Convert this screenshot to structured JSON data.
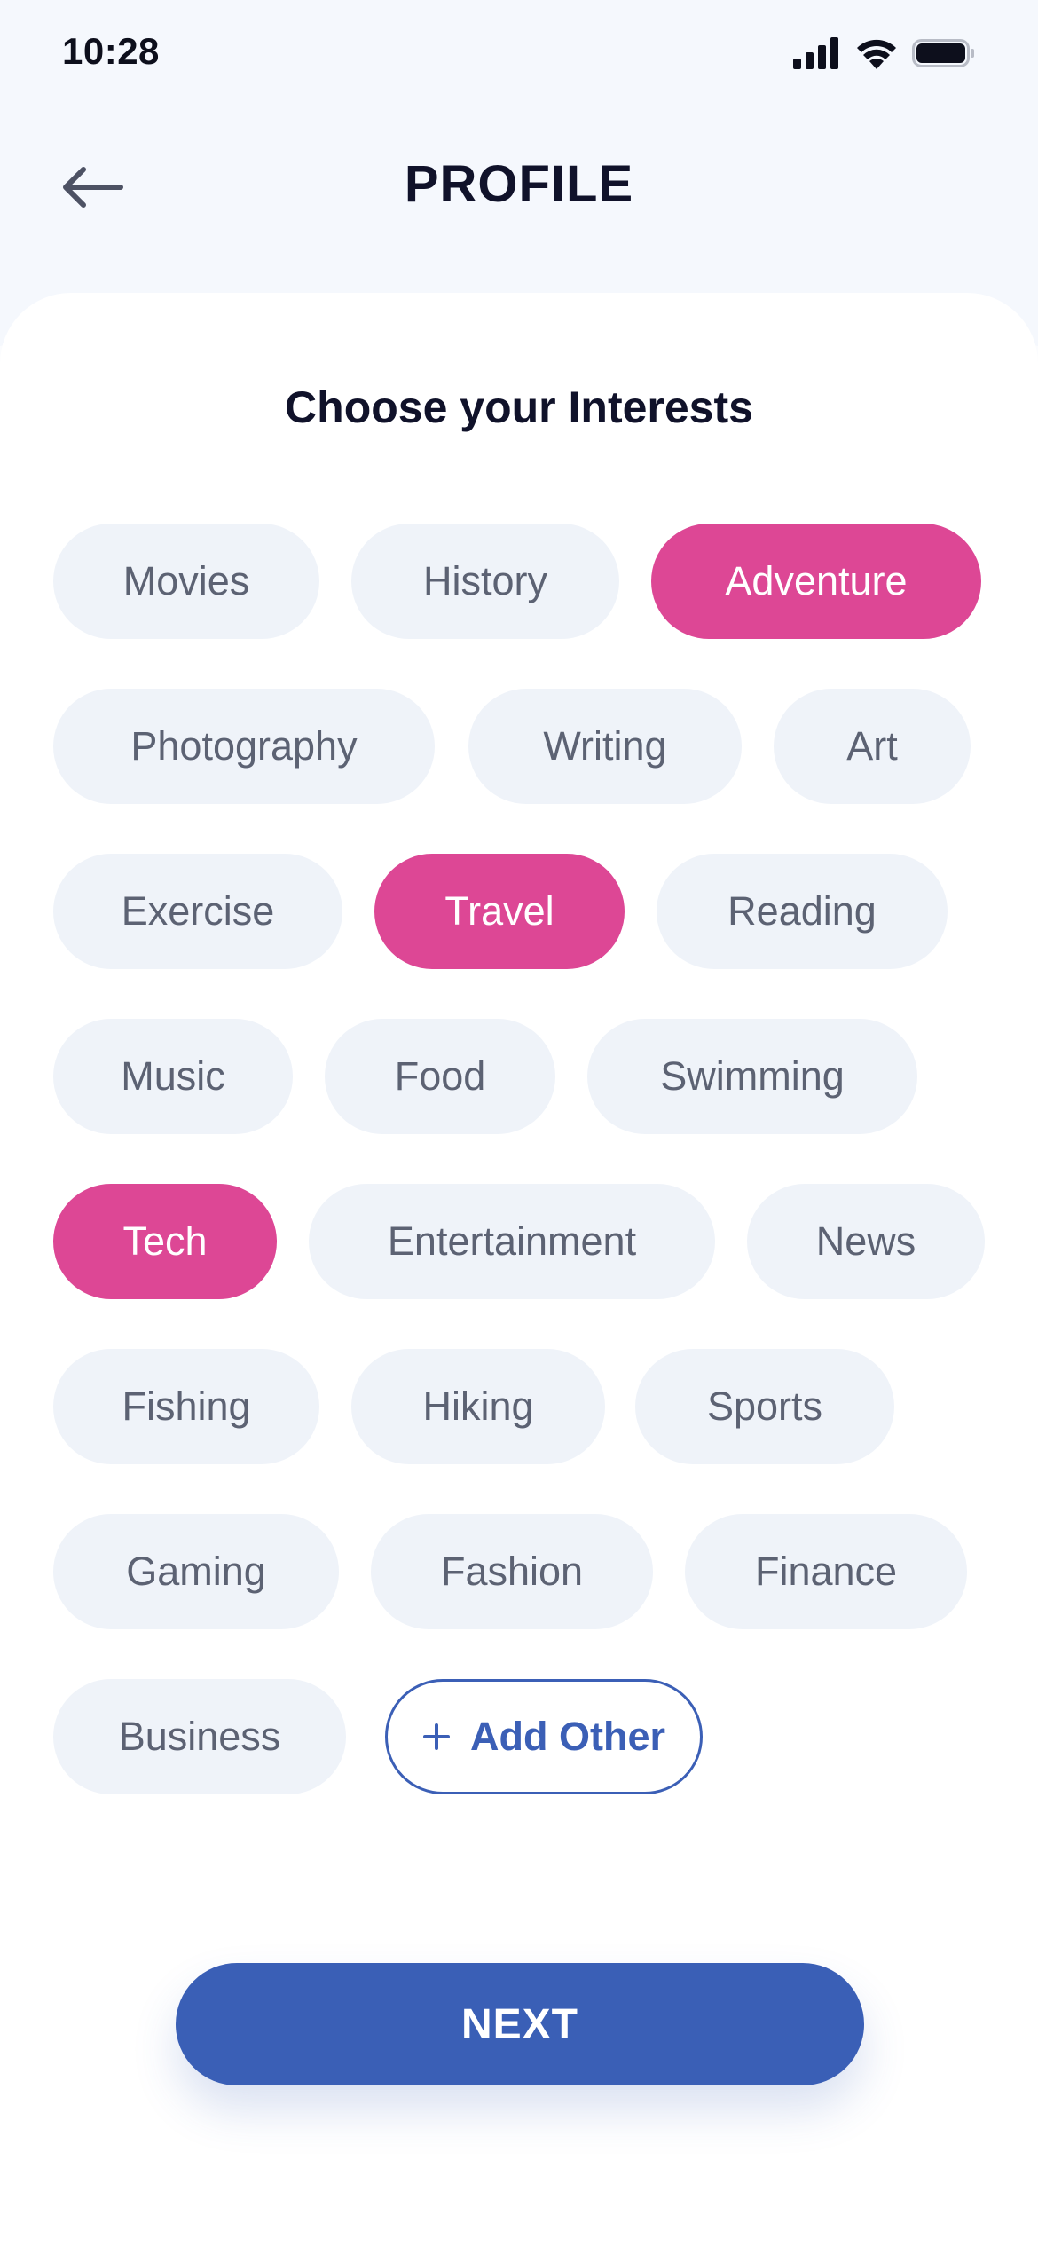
{
  "status_bar": {
    "time": "10:28"
  },
  "header": {
    "title": "PROFILE"
  },
  "section_title": "Choose your Interests",
  "interests": [
    {
      "label": "Movies",
      "selected": false
    },
    {
      "label": "History",
      "selected": false
    },
    {
      "label": "Adventure",
      "selected": true
    },
    {
      "label": "Photography",
      "selected": false
    },
    {
      "label": "Writing",
      "selected": false
    },
    {
      "label": "Art",
      "selected": false
    },
    {
      "label": "Exercise",
      "selected": false
    },
    {
      "label": "Travel",
      "selected": true
    },
    {
      "label": "Reading",
      "selected": false
    },
    {
      "label": "Music",
      "selected": false
    },
    {
      "label": "Food",
      "selected": false
    },
    {
      "label": "Swimming",
      "selected": false
    },
    {
      "label": "Tech",
      "selected": true
    },
    {
      "label": "Entertainment",
      "selected": false
    },
    {
      "label": "News",
      "selected": false
    },
    {
      "label": "Fishing",
      "selected": false
    },
    {
      "label": "Hiking",
      "selected": false
    },
    {
      "label": "Sports",
      "selected": false
    },
    {
      "label": "Gaming",
      "selected": false
    },
    {
      "label": "Fashion",
      "selected": false
    },
    {
      "label": "Finance",
      "selected": false
    },
    {
      "label": "Business",
      "selected": false
    }
  ],
  "add_other": {
    "label": "Add Other"
  },
  "next_button": {
    "label": "NEXT"
  },
  "colors": {
    "selected_chip": "#dd4795",
    "unselected_chip": "#eff3f9",
    "primary": "#3a5fb6"
  }
}
